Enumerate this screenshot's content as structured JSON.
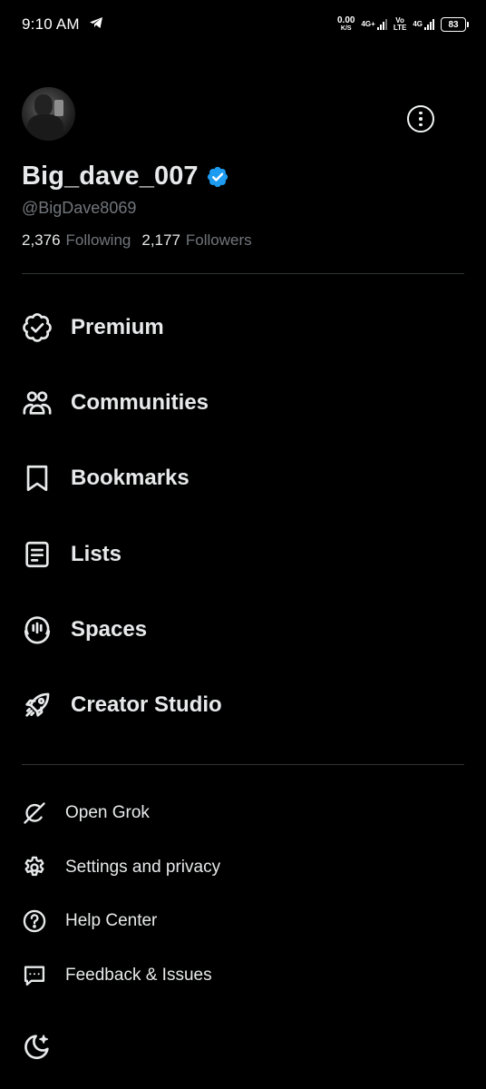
{
  "status_bar": {
    "time": "9:10 AM",
    "net_speed_value": "0.00",
    "net_speed_unit": "K/S",
    "sim1_label": "4G+",
    "sim2_label_top": "Vo",
    "sim2_label_bottom": "LTE",
    "sim3_label": "4G",
    "battery": "83"
  },
  "profile": {
    "display_name": "Big_dave_007",
    "handle": "@BigDave8069",
    "following_count": "2,376",
    "following_label": "Following",
    "followers_count": "2,177",
    "followers_label": "Followers",
    "verified_color": "#1d9bf0"
  },
  "menu": [
    {
      "label": "Premium",
      "icon": "premium-badge-icon"
    },
    {
      "label": "Communities",
      "icon": "communities-icon"
    },
    {
      "label": "Bookmarks",
      "icon": "bookmark-icon"
    },
    {
      "label": "Lists",
      "icon": "lists-icon"
    },
    {
      "label": "Spaces",
      "icon": "spaces-icon"
    },
    {
      "label": "Creator Studio",
      "icon": "rocket-icon"
    }
  ],
  "secondary_menu": [
    {
      "label": "Open Grok",
      "icon": "grok-icon"
    },
    {
      "label": "Settings and privacy",
      "icon": "gear-icon"
    },
    {
      "label": "Help Center",
      "icon": "help-icon"
    },
    {
      "label": "Feedback & Issues",
      "icon": "feedback-icon"
    }
  ],
  "colors": {
    "background": "#000000",
    "text": "#e7e9ea",
    "secondary_text": "#71767b",
    "divider": "#2f3336",
    "accent": "#1d9bf0"
  }
}
